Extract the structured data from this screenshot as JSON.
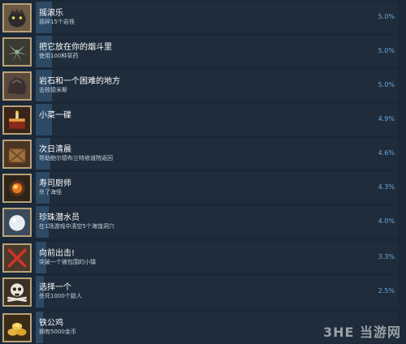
{
  "colors": {
    "background": "#1b2838",
    "row_bg": "#1e2c3b",
    "bar": "#2d4964",
    "percent_text": "#6fa8dc",
    "icon_border": "#b9a27a"
  },
  "achievements": [
    {
      "title": "摇滚乐",
      "desc": "摇碎15个岩怪",
      "percent": "5.0%",
      "value": 5.0,
      "icon": "rock-monster-icon"
    },
    {
      "title": "把它放在你的烟斗里",
      "desc": "使用100种草药",
      "percent": "5.0%",
      "value": 5.0,
      "icon": "herb-icon"
    },
    {
      "title": "岩石和一个困难的地方",
      "desc": "击败德米斯",
      "percent": "5.0%",
      "value": 5.0,
      "icon": "boulder-icon"
    },
    {
      "title": "小菜一碟",
      "desc": "",
      "percent": "4.9%",
      "value": 4.9,
      "icon": "cake-icon"
    },
    {
      "title": "次日清晨",
      "desc": "帮助鲍尔德布兰特修道院返回",
      "percent": "4.6%",
      "value": 4.6,
      "icon": "crate-icon"
    },
    {
      "title": "寿司厨师",
      "desc": "杀了海怪",
      "percent": "4.3%",
      "value": 4.3,
      "icon": "orb-icon"
    },
    {
      "title": "珍珠潜水员",
      "desc": "在1场游戏中清空5个海蚀洞穴",
      "percent": "4.0%",
      "value": 4.0,
      "icon": "pearl-icon"
    },
    {
      "title": "向前出击!",
      "desc": "突破一个被包围的小镇",
      "percent": "3.3%",
      "value": 3.3,
      "icon": "crossed-swords-icon"
    },
    {
      "title": "选择一个",
      "desc": "杀死1000个敌人",
      "percent": "2.5%",
      "value": 2.5,
      "icon": "skull-crossbones-icon"
    },
    {
      "title": "铁公鸡",
      "desc": "拥有5000金币",
      "percent": "",
      "value": 2.3,
      "icon": "gold-coins-icon"
    }
  ],
  "watermark": "3HE 当游网"
}
